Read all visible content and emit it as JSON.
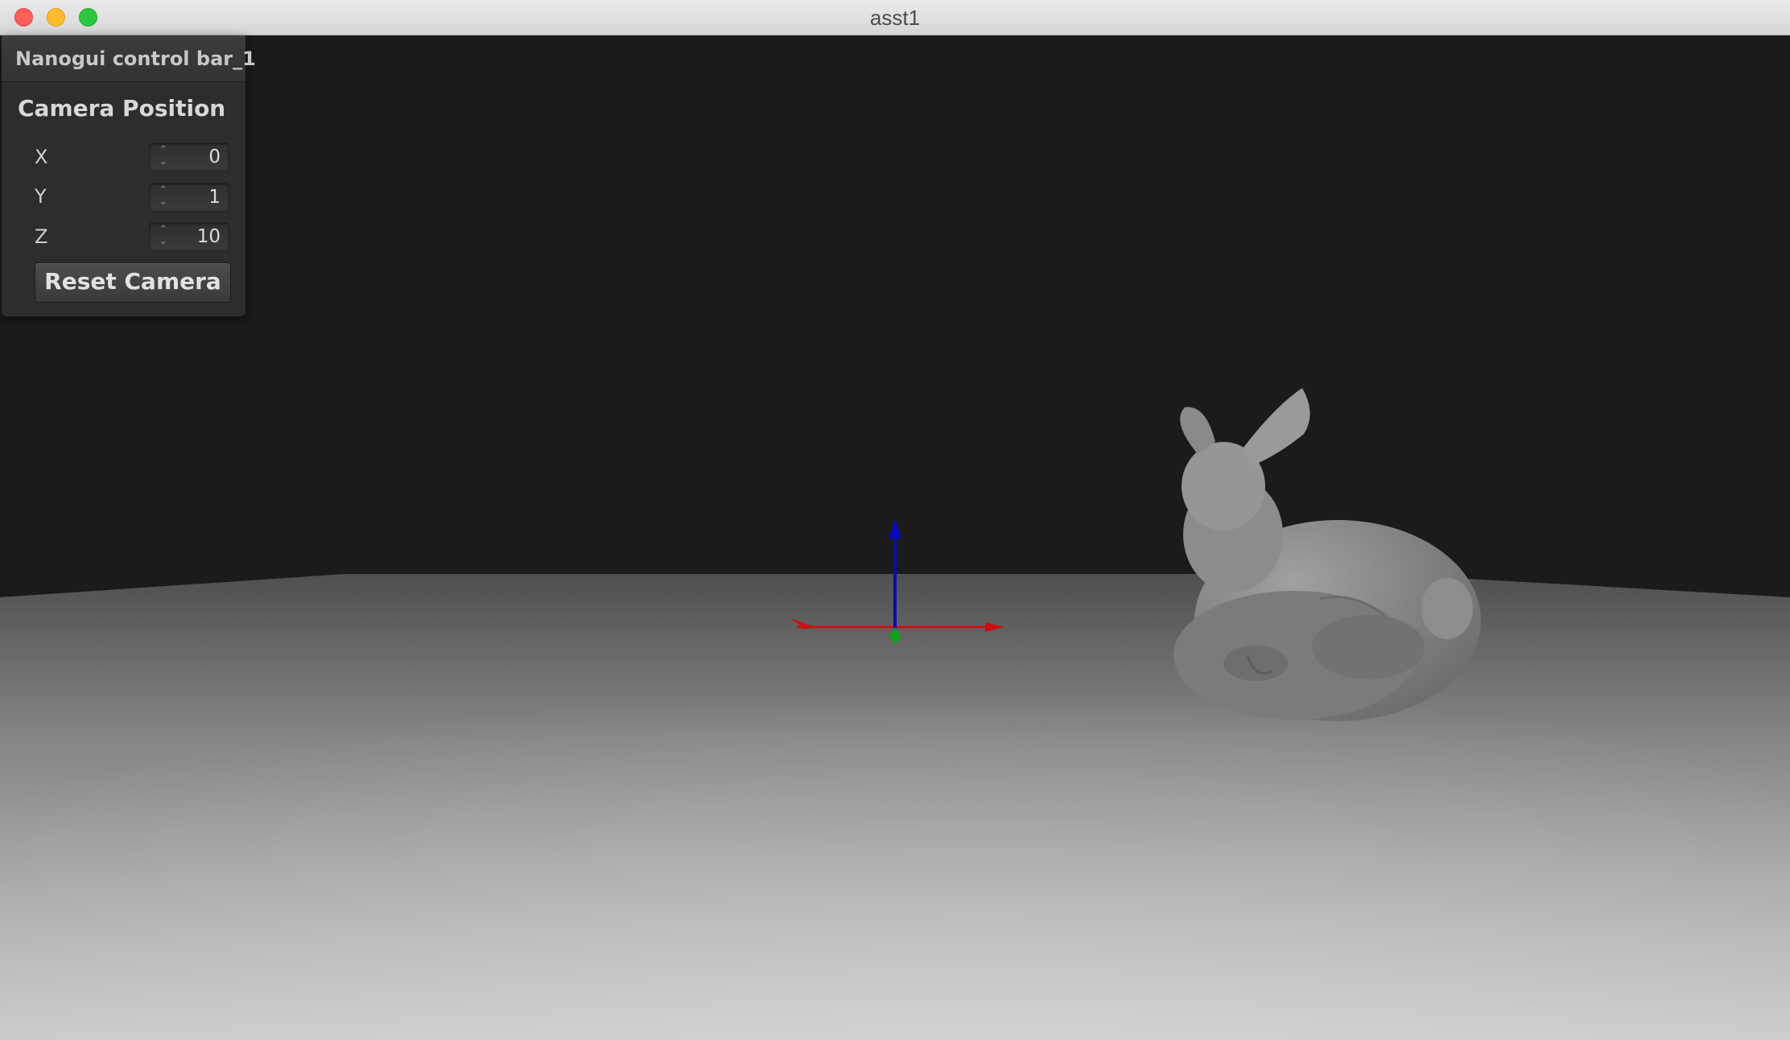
{
  "window": {
    "title": "asst1"
  },
  "panel": {
    "title": "Nanogui control bar_1",
    "section": "Camera Position",
    "fields": [
      {
        "label": "X",
        "value": "0"
      },
      {
        "label": "Y",
        "value": "1"
      },
      {
        "label": "Z",
        "value": "10"
      }
    ],
    "reset_label": "Reset Camera"
  },
  "scene": {
    "background_color": "#1b1b1b",
    "floor_colors": [
      "#4a4a4a",
      "#cfcfcf"
    ],
    "axes": {
      "x_color": "#cc1010",
      "y_color": "#0a0ab8",
      "z_color": "#10a020"
    },
    "model": "bunny"
  }
}
